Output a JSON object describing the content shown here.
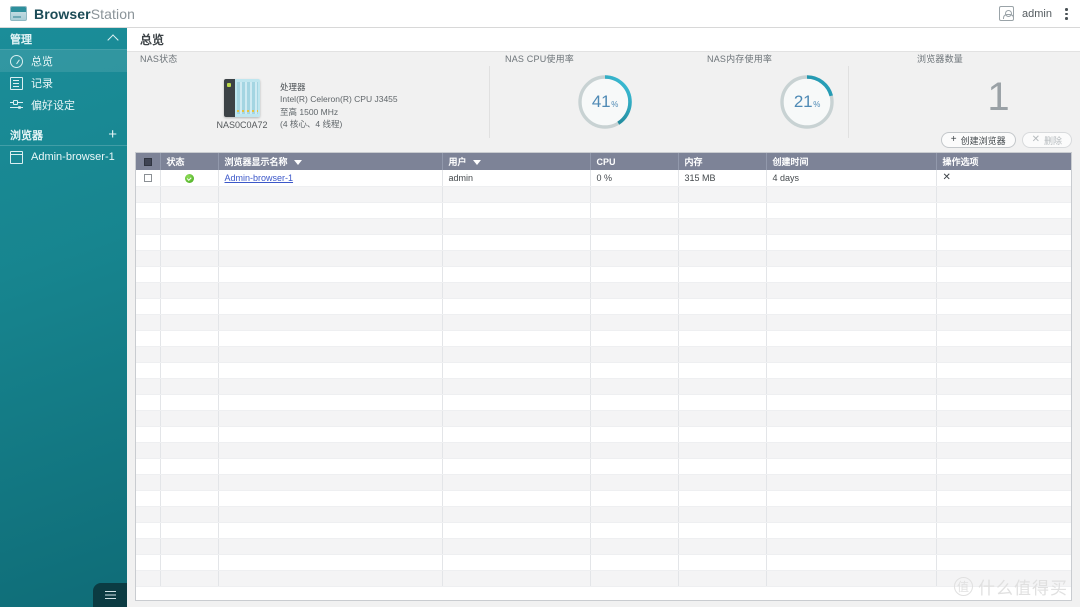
{
  "app": {
    "brand_bold": "Browser",
    "brand_light": "Station",
    "logo_icon": "browser-window-icon",
    "accent_color": "#2aa3ab"
  },
  "topbar": {
    "user_icon": "user-avatar-icon",
    "user_name": "admin",
    "menu_icon": "kebab-menu-icon"
  },
  "sidebar": {
    "groups": [
      {
        "title": "管理",
        "action_icon": "chevron-up-icon",
        "items": [
          {
            "label": "总览",
            "icon": "gauge-icon",
            "active": true
          },
          {
            "label": "记录",
            "icon": "document-icon",
            "active": false
          },
          {
            "label": "偏好设定",
            "icon": "sliders-icon",
            "active": false
          }
        ]
      },
      {
        "title": "浏览器",
        "action_icon": "plus-icon",
        "items": [
          {
            "label": "Admin-browser-1",
            "icon": "browser-window-icon",
            "active": false
          }
        ]
      }
    ],
    "collapse_icon": "hamburger-icon"
  },
  "page": {
    "title": "总览"
  },
  "dashboard": {
    "nas_status": {
      "label": "NAS状态",
      "device_icon": "nas-device-icon",
      "device_name": "NAS0C0A72",
      "cpu_heading": "处理器",
      "cpu_model": "Intel(R) Celeron(R) CPU J3455",
      "cpu_clock": "至高 1500 MHz",
      "cpu_cores": "(4 核心、4 线程)"
    },
    "cpu_usage": {
      "label": "NAS CPU使用率",
      "value": 41,
      "value_text": "41",
      "unit": "%"
    },
    "memory_usage": {
      "label": "NAS内存使用率",
      "value": 21,
      "value_text": "21",
      "unit": "%"
    },
    "browser_count": {
      "label": "浏览器数量",
      "value": "1"
    },
    "buttons": {
      "create": {
        "label": "创建浏览器",
        "icon": "plus-icon",
        "disabled": false
      },
      "delete": {
        "label": "删除",
        "icon": "close-x-icon",
        "disabled": true
      }
    }
  },
  "table": {
    "columns": [
      {
        "key": "check",
        "label": "",
        "filter": false
      },
      {
        "key": "status",
        "label": "状态",
        "filter": false
      },
      {
        "key": "name",
        "label": "浏览器显示名称",
        "filter": true
      },
      {
        "key": "user",
        "label": "用户",
        "filter": true
      },
      {
        "key": "cpu",
        "label": "CPU",
        "filter": false
      },
      {
        "key": "memory",
        "label": "内存",
        "filter": false
      },
      {
        "key": "created",
        "label": "创建时间",
        "filter": false
      },
      {
        "key": "actions",
        "label": "操作选项",
        "filter": false
      }
    ],
    "rows": [
      {
        "status_icon": "status-ok-icon",
        "name": "Admin-browser-1",
        "user": "admin",
        "cpu": "0 %",
        "memory": "315 MB",
        "created": "4 days",
        "action_icon": "close-x-icon",
        "action_label": "✕"
      }
    ],
    "empty_rows": 25
  },
  "watermark": {
    "badge": "值",
    "text": "什么值得买"
  }
}
